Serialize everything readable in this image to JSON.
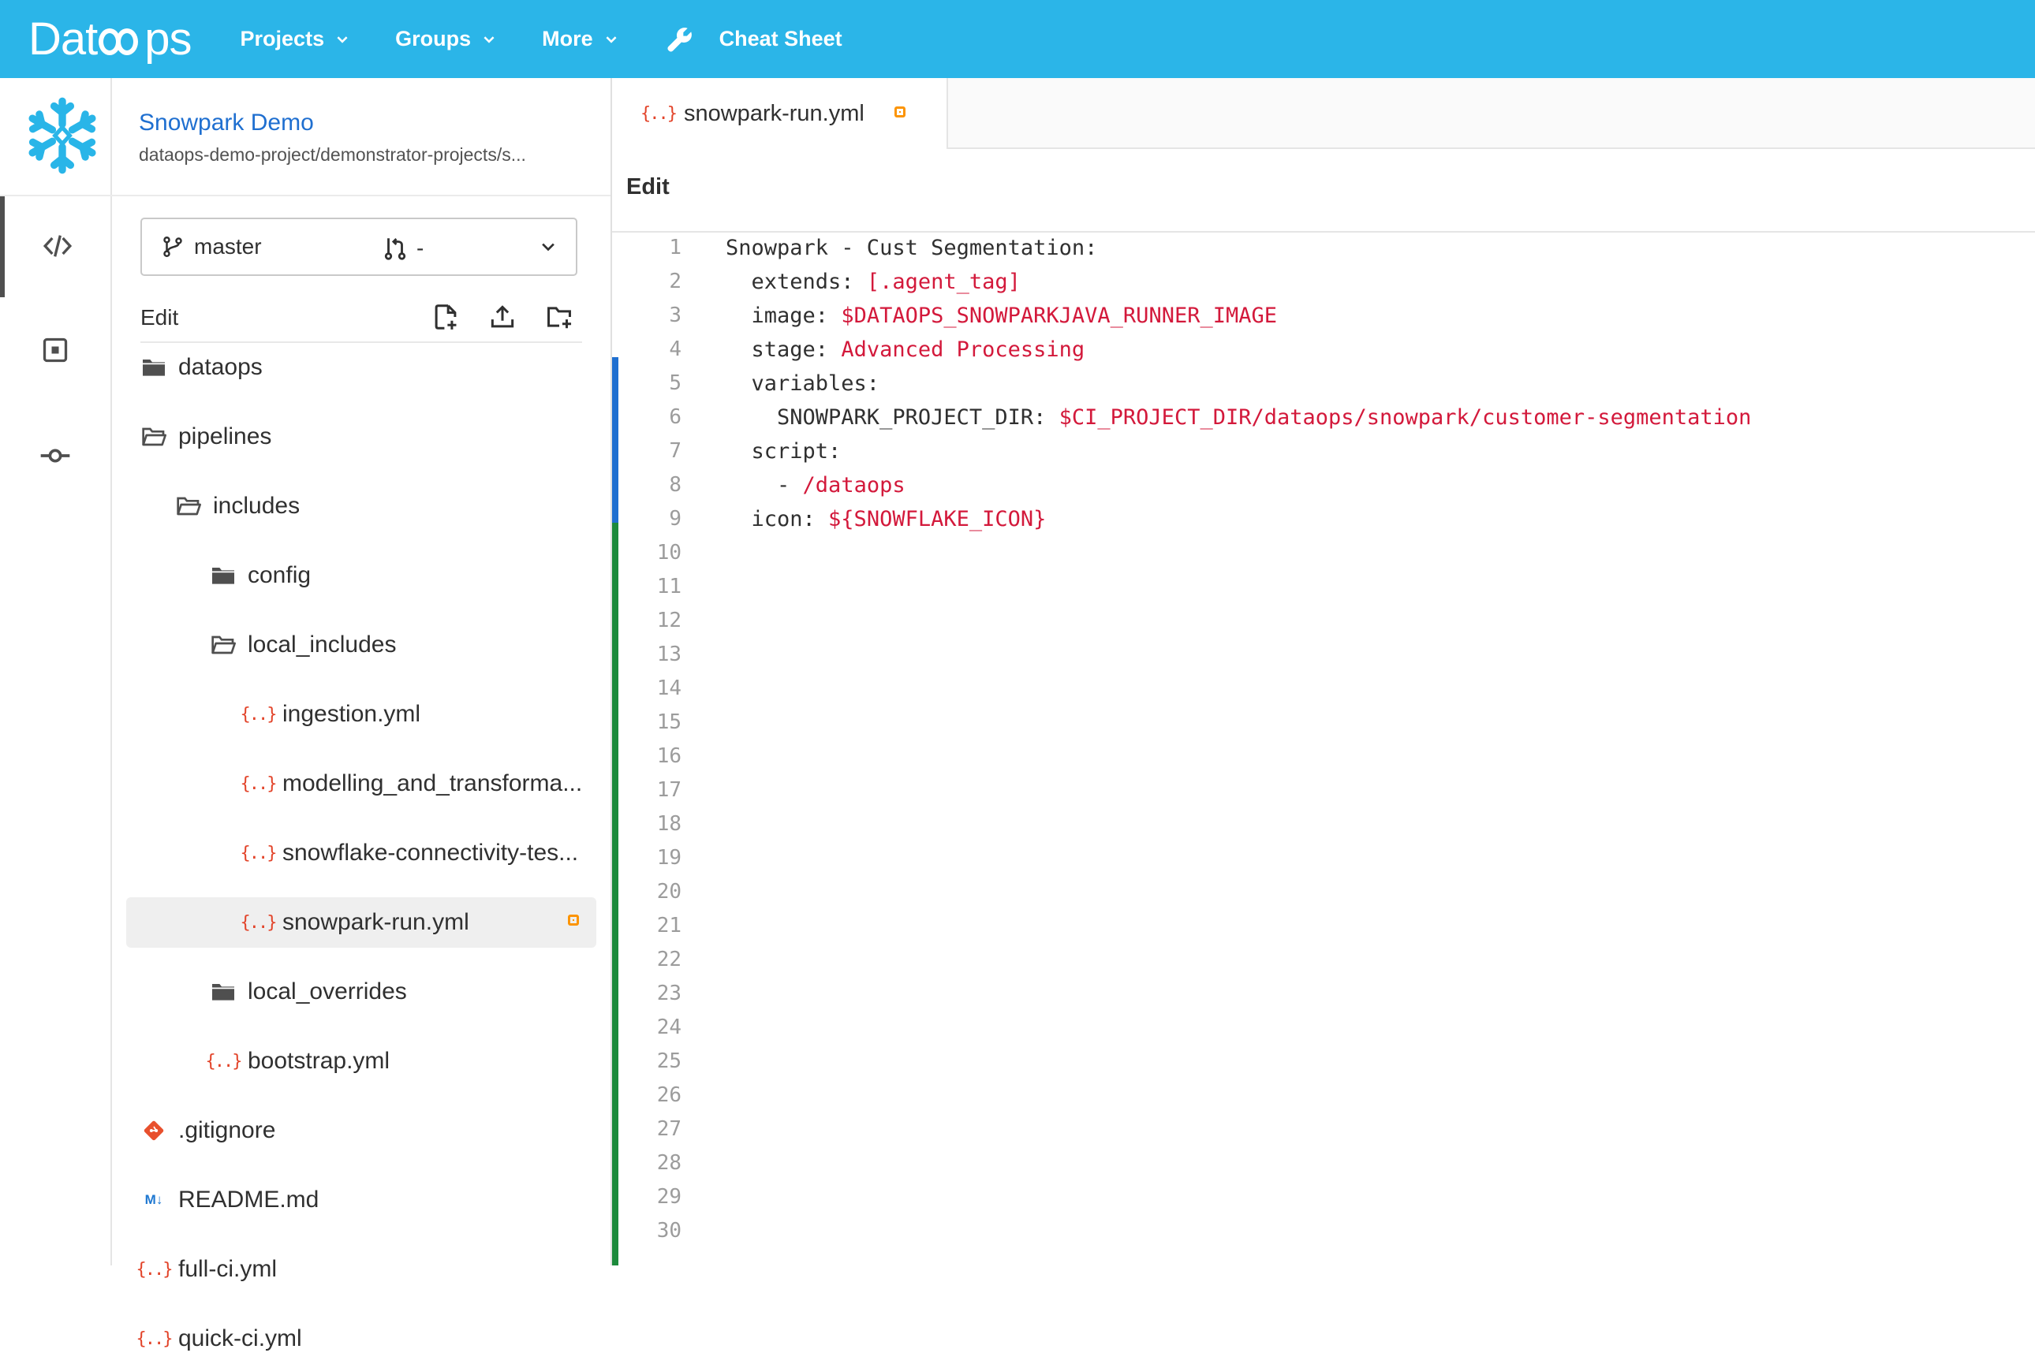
{
  "navbar": {
    "logo": "Dataops",
    "items": [
      {
        "label": "Projects"
      },
      {
        "label": "Groups"
      },
      {
        "label": "More"
      }
    ],
    "cheat_sheet": "Cheat Sheet",
    "color": "#2bb5e8"
  },
  "project": {
    "name": "Snowpark Demo",
    "path": "dataops-demo-project/demonstrator-projects/s...",
    "avatar_icon": "snowflake-icon"
  },
  "rail": [
    "code-icon",
    "review-icon",
    "commit-icon"
  ],
  "branch": {
    "name": "master",
    "merge_request": "-"
  },
  "tree_header": {
    "label": "Edit"
  },
  "tree": [
    {
      "label": "dataops",
      "icon": "folder",
      "depth": 0
    },
    {
      "label": "pipelines",
      "icon": "folder-open",
      "depth": 0
    },
    {
      "label": "includes",
      "icon": "folder-open",
      "depth": 1
    },
    {
      "label": "config",
      "icon": "folder",
      "depth": 2
    },
    {
      "label": "local_includes",
      "icon": "folder-open",
      "depth": 2
    },
    {
      "label": "ingestion.yml",
      "icon": "yml",
      "depth": 3
    },
    {
      "label": "modelling_and_transforma...",
      "icon": "yml",
      "depth": 3
    },
    {
      "label": "snowflake-connectivity-tes...",
      "icon": "yml",
      "depth": 3
    },
    {
      "label": "snowpark-run.yml",
      "icon": "yml",
      "depth": 3,
      "selected": true,
      "modified": true
    },
    {
      "label": "local_overrides",
      "icon": "folder",
      "depth": 2
    },
    {
      "label": "bootstrap.yml",
      "icon": "yml",
      "depth": 2
    },
    {
      "label": ".gitignore",
      "icon": "git",
      "depth": 0
    },
    {
      "label": "README.md",
      "icon": "markdown",
      "depth": 0
    },
    {
      "label": "full-ci.yml",
      "icon": "yml",
      "depth": 0
    },
    {
      "label": "quick-ci.yml",
      "icon": "yml",
      "depth": 0
    }
  ],
  "editor": {
    "tab_label": "snowpark-run.yml",
    "mode": "Edit",
    "line_numbers": [
      "1",
      "2",
      "3",
      "4",
      "5",
      "6",
      "7",
      "8",
      "9",
      "10",
      "11",
      "12",
      "13",
      "14",
      "15",
      "16",
      "17",
      "18",
      "19",
      "20",
      "21",
      "22",
      "23",
      "24",
      "25",
      "26",
      "27",
      "28",
      "29",
      "30"
    ],
    "lines": [
      {
        "key": "Snowpark - Cust Segmentation:",
        "value": ""
      },
      {
        "key": "  extends: ",
        "value": "[.agent_tag]"
      },
      {
        "key": "  image: ",
        "value": "$DATAOPS_SNOWPARKJAVA_RUNNER_IMAGE"
      },
      {
        "key": "  stage: ",
        "value": "Advanced Processing"
      },
      {
        "key": "  variables:",
        "value": ""
      },
      {
        "key": "    SNOWPARK_PROJECT_DIR: ",
        "value": "$CI_PROJECT_DIR/dataops/snowpark/customer-segmentation"
      },
      {
        "key": "  script:",
        "value": ""
      },
      {
        "key": "    - ",
        "value": "/dataops"
      },
      {
        "key": "  icon: ",
        "value": "${SNOWFLAKE_ICON}"
      }
    ],
    "colors": {
      "key": "#303030",
      "value": "#d3193b",
      "gutter_modified": "#1f6fd0",
      "gutter_added": "#1c8a3c"
    }
  }
}
